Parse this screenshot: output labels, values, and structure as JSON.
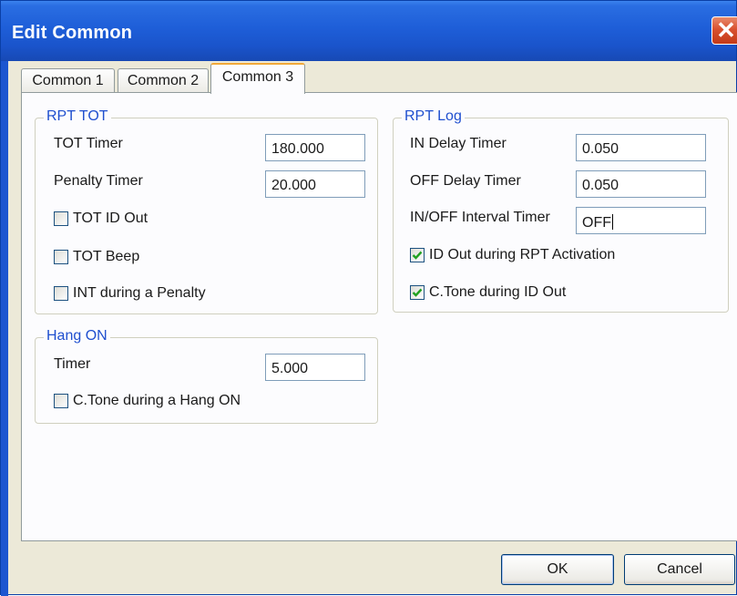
{
  "window": {
    "title": "Edit Common",
    "close_label": "✕"
  },
  "tabs": [
    {
      "label": "Common 1",
      "active": false
    },
    {
      "label": "Common 2",
      "active": false
    },
    {
      "label": "Common 3",
      "active": true
    }
  ],
  "rpt_tot": {
    "title": "RPT TOT",
    "tot_timer_label": "TOT Timer",
    "tot_timer_value": "180.000",
    "penalty_timer_label": "Penalty Timer",
    "penalty_timer_value": "20.000",
    "checkboxes": [
      {
        "label": "TOT ID Out",
        "checked": false
      },
      {
        "label": "TOT Beep",
        "checked": false
      },
      {
        "label": "INT during a Penalty",
        "checked": false
      }
    ]
  },
  "rpt_log": {
    "title": "RPT Log",
    "in_delay_label": "IN Delay Timer",
    "in_delay_value": "0.050",
    "off_delay_label": "OFF Delay Timer",
    "off_delay_value": "0.050",
    "interval_label": "IN/OFF Interval Timer",
    "interval_value": "OFF",
    "checkboxes": [
      {
        "label": "ID Out during RPT Activation",
        "checked": true
      },
      {
        "label": "C.Tone during ID Out",
        "checked": true
      }
    ]
  },
  "hang_on": {
    "title": "Hang ON",
    "timer_label": "Timer",
    "timer_value": "5.000",
    "checkbox": {
      "label": "C.Tone during a Hang ON",
      "checked": false
    }
  },
  "buttons": {
    "ok": "OK",
    "cancel": "Cancel"
  }
}
